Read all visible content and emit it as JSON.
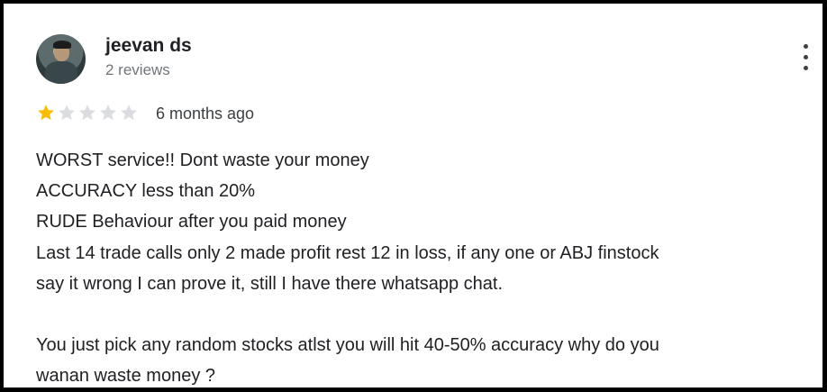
{
  "review": {
    "author_name": "jeevan ds",
    "author_meta": "2 reviews",
    "rating": 1,
    "rating_max": 5,
    "time_ago": "6 months ago",
    "text_lines": [
      "WORST service!! Dont waste your money",
      "ACCURACY less than 20%",
      "RUDE Behaviour after you paid money",
      "Last 14 trade calls only 2 made profit rest 12 in loss, if any one or ABJ finstock",
      "say it wrong I can prove it, still I have there whatsapp chat.",
      "",
      "You just pick any random stocks atlst you will hit 40-50% accuracy why do you",
      "wanan waste money ?"
    ]
  },
  "colors": {
    "star_filled": "#fbbc04",
    "star_empty": "#dadce0",
    "frame": "#000000"
  },
  "icons": {
    "menu": "more-vert-icon",
    "star": "star-icon"
  }
}
